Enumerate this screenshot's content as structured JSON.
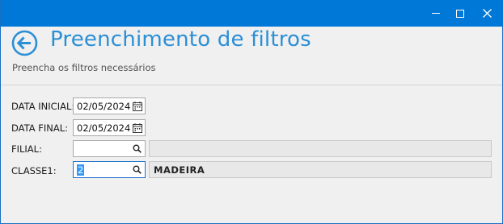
{
  "window": {
    "controls": {
      "minimize_icon": "minimize-icon",
      "maximize_icon": "maximize-icon",
      "close_icon": "close-icon"
    },
    "accent_color": "#0078d7"
  },
  "header": {
    "back_icon": "arrow-left-circle-icon",
    "title": "Preenchimento de filtros",
    "subtitle": "Preencha os filtros necessários",
    "title_color": "#2b8fd6"
  },
  "form": {
    "data_inicial": {
      "label": "DATA INICIAL:",
      "value": "02/05/2024",
      "icon": "calendar-icon"
    },
    "data_final": {
      "label": "DATA FINAL:",
      "value": "02/05/2024",
      "icon": "calendar-icon"
    },
    "filial": {
      "label": "FILIAL:",
      "value": "",
      "icon": "search-icon",
      "description": ""
    },
    "classe1": {
      "label": "CLASSE1:",
      "value": "2",
      "icon": "search-icon",
      "description": "MADEIRA"
    }
  }
}
